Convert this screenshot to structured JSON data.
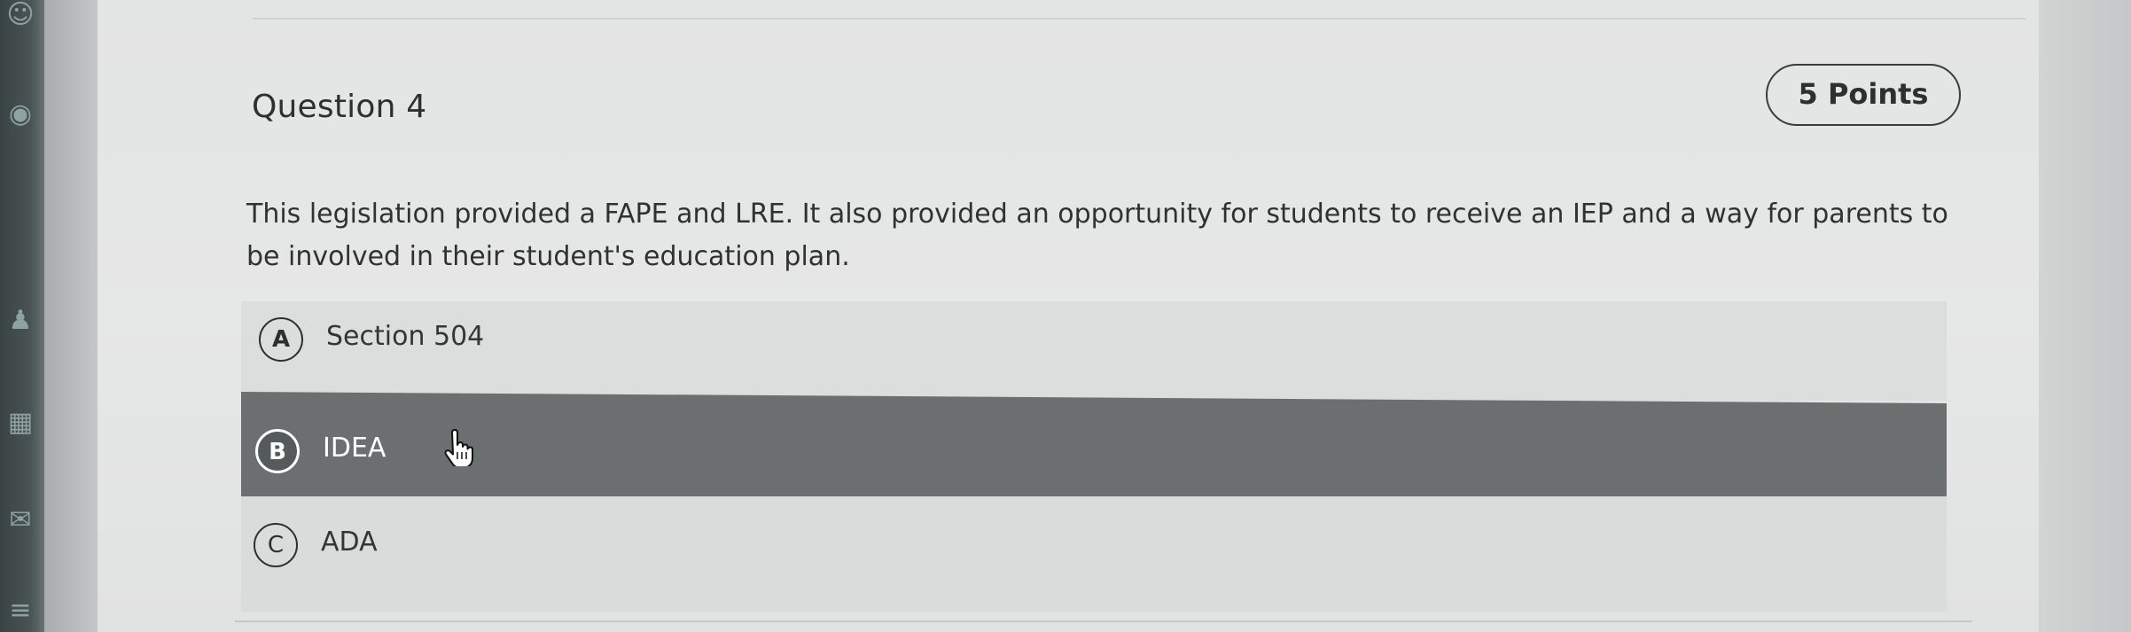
{
  "question": {
    "title": "Question 4",
    "points": "5 Points",
    "text": "This legislation provided a FAPE and LRE. It also provided an opportunity for students to receive an IEP and a way for parents to be involved in their student's education plan."
  },
  "options": [
    {
      "letter": "A",
      "label": "Section 504",
      "selected": false
    },
    {
      "letter": "B",
      "label": "IDEA",
      "selected": true
    },
    {
      "letter": "C",
      "label": "ADA",
      "selected": false
    }
  ],
  "icons": {
    "rail": [
      "user-icon",
      "globe-icon",
      "people-icon",
      "calendar-icon",
      "mail-icon",
      "menu-icon"
    ],
    "cursor": "hand-pointer-icon"
  },
  "colors": {
    "selected_bg": "#6b6f70",
    "option_bg": "#dcdede",
    "text": "#2f3132"
  }
}
